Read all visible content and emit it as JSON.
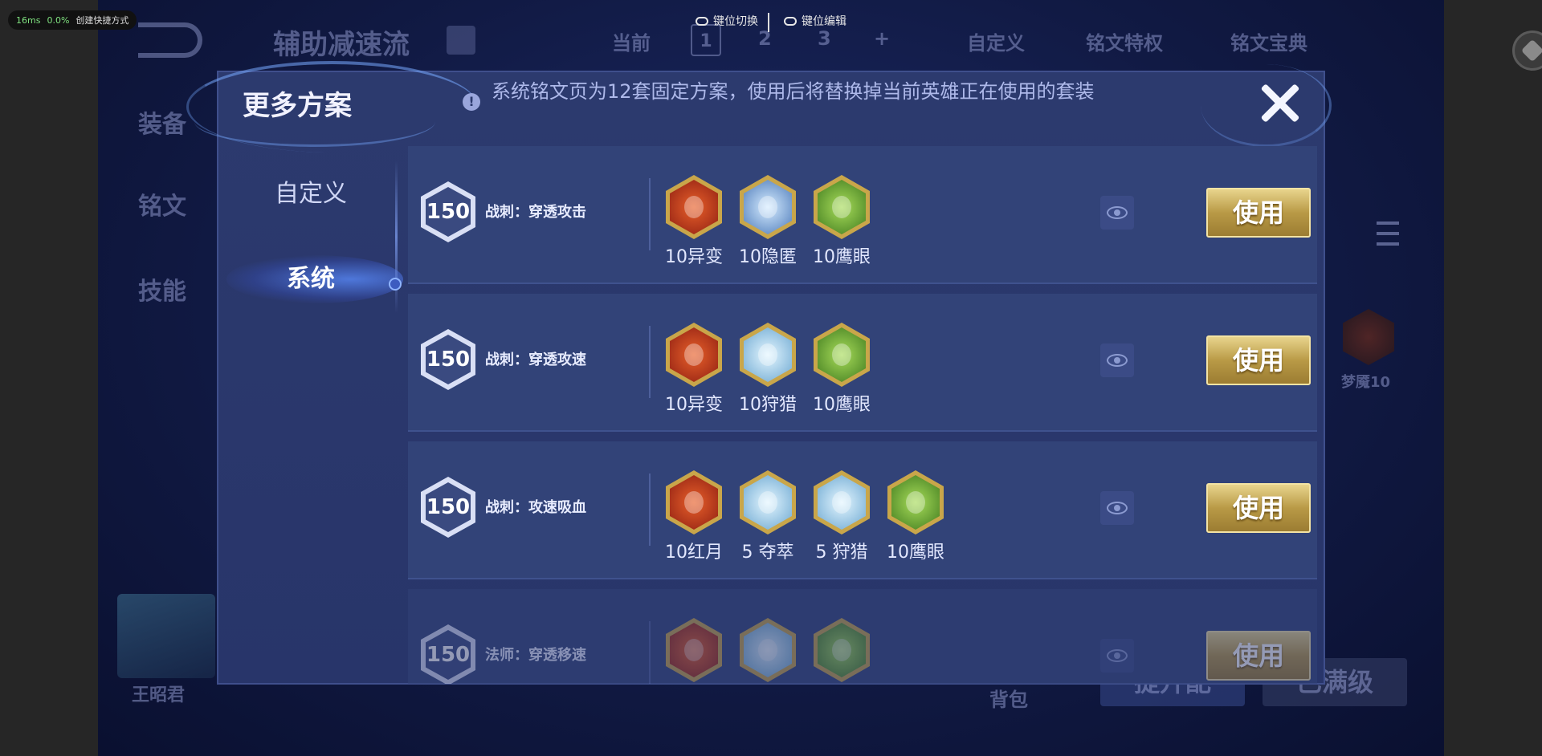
{
  "overlay": {
    "perf_ms": "16ms",
    "perf_pct": "0.0%",
    "shortcut": "创建快捷方式",
    "key_switch": "键位切换",
    "key_edit": "键位编辑"
  },
  "background": {
    "page_title": "辅助减速流",
    "tabs_current": "当前",
    "page_numbers": [
      "1",
      "2",
      "3"
    ],
    "plus": "+",
    "custom": "自定义",
    "privilege": "铭文特权",
    "codex": "铭文宝典",
    "left_nav": [
      "装备",
      "铭文",
      "技能"
    ],
    "hero_name": "王昭君",
    "side_rune_label": "梦魇10",
    "bag": "背包",
    "max_level": "已满级",
    "upgrade": "提升配"
  },
  "modal": {
    "title": "更多方案",
    "notice": "系统铭文页为12套固定方案，使用后将替换掉当前英雄正在使用的套装",
    "tabs": [
      {
        "label": "自定义",
        "active": false
      },
      {
        "label": "系统",
        "active": true
      }
    ],
    "use_label": "使用",
    "rows": [
      {
        "level": "150",
        "name": "战刺：穿透攻击",
        "runes": [
          {
            "label": "10异变",
            "color": "red"
          },
          {
            "label": "10隐匿",
            "color": "blue"
          },
          {
            "label": "10鹰眼",
            "color": "green"
          }
        ]
      },
      {
        "level": "150",
        "name": "战刺：穿透攻速",
        "runes": [
          {
            "label": "10异变",
            "color": "red"
          },
          {
            "label": "10狩猎",
            "color": "cyan"
          },
          {
            "label": "10鹰眼",
            "color": "green"
          }
        ]
      },
      {
        "level": "150",
        "name": "战刺：攻速吸血",
        "runes": [
          {
            "label": "10红月",
            "color": "red"
          },
          {
            "label": "5 夺萃",
            "color": "cyan"
          },
          {
            "label": "5 狩猎",
            "color": "cyan"
          },
          {
            "label": "10鹰眼",
            "color": "green"
          }
        ]
      },
      {
        "level": "150",
        "name": "法师：穿透移速",
        "runes": [
          {
            "label": "",
            "color": "red"
          },
          {
            "label": "",
            "color": "cyan"
          },
          {
            "label": "",
            "color": "green"
          }
        ]
      }
    ]
  }
}
